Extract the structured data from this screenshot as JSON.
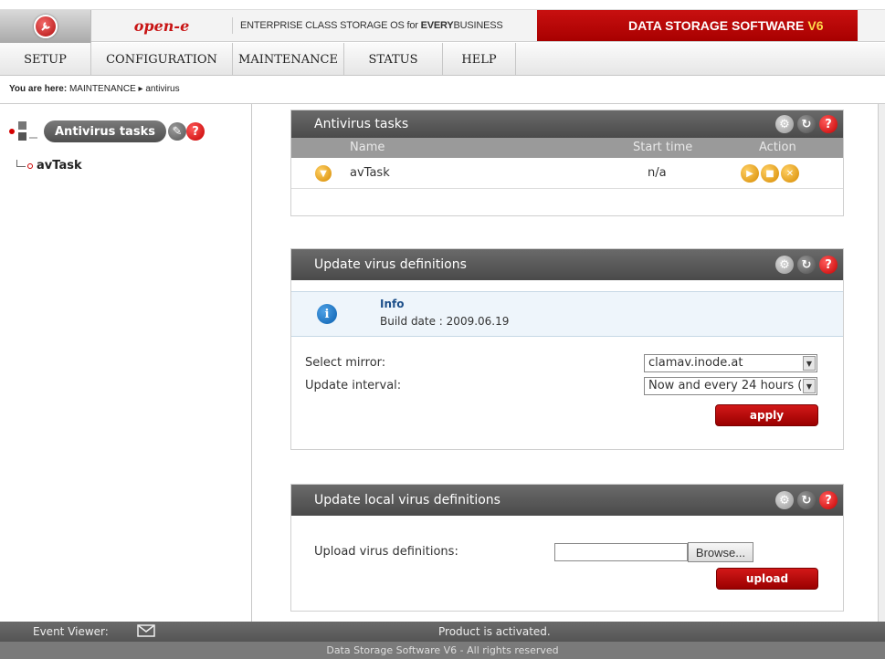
{
  "header": {
    "brand_prefix": "open-",
    "brand_suffix": "e",
    "tagline_pre": "ENTERPRISE CLASS STORAGE OS for ",
    "tagline_bold": "EVERY",
    "tagline_post": " BUSINESS",
    "product": "DATA STORAGE SOFTWARE",
    "product_version": "V6",
    "accent_color": "#c81010"
  },
  "nav": [
    "SETUP",
    "CONFIGURATION",
    "MAINTENANCE",
    "STATUS",
    "HELP"
  ],
  "breadcrumb": {
    "label": "You are here:",
    "path": "MAINTENANCE",
    "separator": "▸",
    "current": "antivirus"
  },
  "tree": {
    "title": "Antivirus tasks",
    "node": "avTask"
  },
  "tasks_panel": {
    "title": "Antivirus tasks",
    "columns": {
      "name": "Name",
      "start_time": "Start time",
      "action": "Action"
    },
    "rows": [
      {
        "name": "avTask",
        "start_time": "n/a"
      }
    ]
  },
  "update_panel": {
    "title": "Update virus definitions",
    "info_title": "Info",
    "info_text": "Build date : 2009.06.19",
    "mirror_label": "Select mirror:",
    "mirror_value": "clamav.inode.at",
    "interval_label": "Update interval:",
    "interval_value": "Now and every 24 hours (",
    "apply_label": "apply"
  },
  "local_panel": {
    "title": "Update local virus definitions",
    "upload_label": "Upload virus definitions:",
    "browse_label": "Browse...",
    "upload_button": "upload"
  },
  "status": {
    "event_viewer": "Event Viewer:",
    "activation": "Product is activated."
  },
  "footer": "Data Storage Software V6 - All rights reserved"
}
